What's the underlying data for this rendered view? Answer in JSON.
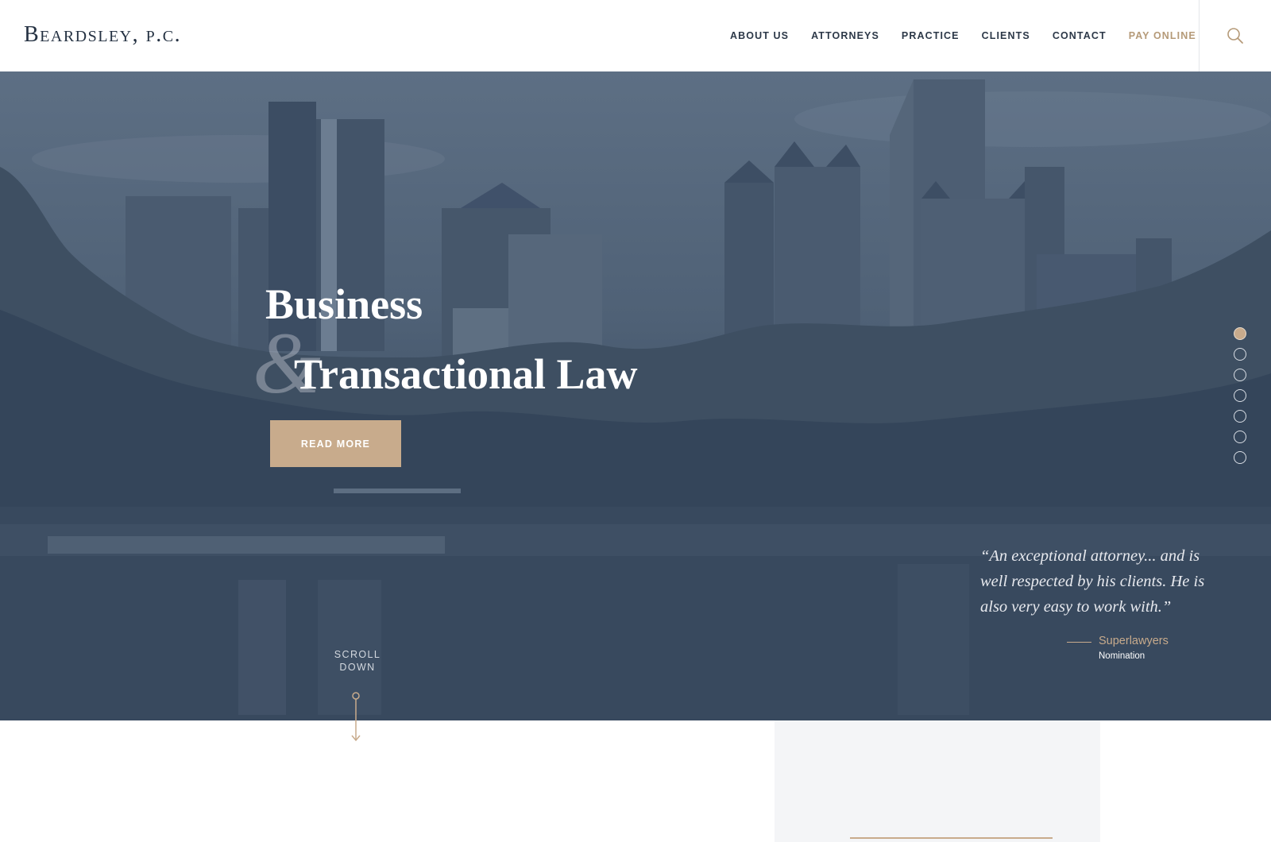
{
  "header": {
    "logo": "Beardsley, p.c.",
    "nav": [
      {
        "label": "ABOUT US"
      },
      {
        "label": "ATTORNEYS"
      },
      {
        "label": "PRACTICE"
      },
      {
        "label": "CLIENTS"
      },
      {
        "label": "CONTACT"
      },
      {
        "label": "PAY ONLINE"
      }
    ],
    "search_icon": "search-icon"
  },
  "hero": {
    "title_line1": "Business",
    "ampersand": "&",
    "title_line2": "Transactional Law",
    "cta_label": "READ MORE",
    "slides": {
      "count": 7,
      "active_index": 0
    },
    "quote": "“An exceptional attorney... and is well respected by his clients. He is also very easy to work with.”",
    "quote_source": "Superlawyers",
    "quote_source_sub": "Nomination",
    "scroll_label_line1": "SCROLL",
    "scroll_label_line2": "DOWN"
  },
  "colors": {
    "accent": "#c8ab8c",
    "navy": "#2c3848",
    "overlay": "#3e5066"
  }
}
